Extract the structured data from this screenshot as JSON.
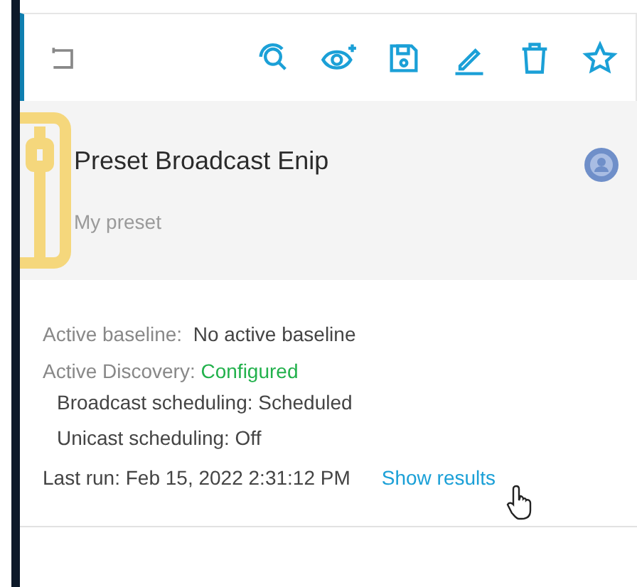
{
  "preset": {
    "title": "Preset Broadcast Enip",
    "subtitle": "My preset"
  },
  "details": {
    "baseline": {
      "label": "Active baseline:",
      "value": "No active baseline"
    },
    "discovery": {
      "label": "Active Discovery:",
      "value": "Configured"
    },
    "schedules": [
      {
        "text": "Broadcast scheduling: Scheduled"
      },
      {
        "text": "Unicast scheduling: Off"
      }
    ],
    "last_run": "Last run: Feb 15, 2022 2:31:12 PM",
    "link": "Show results"
  }
}
